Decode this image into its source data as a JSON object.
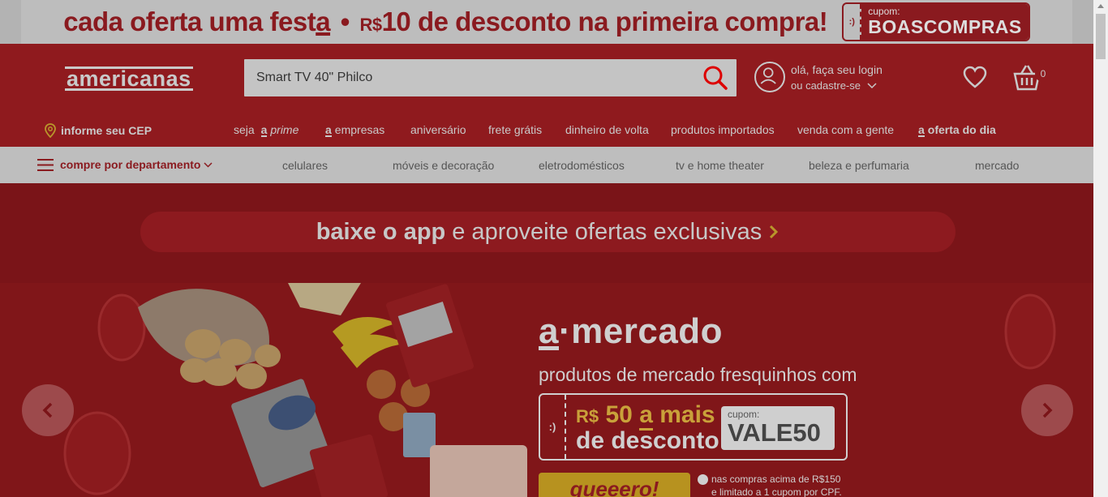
{
  "promo": {
    "text_pre": "cada oferta uma fest",
    "text_a": "a",
    "text_sep": "•",
    "currency": "R$",
    "text_post": "10 de desconto na primeira compra!",
    "coupon_stub": ":)",
    "coupon_label": "cupom:",
    "coupon_code": "BOASCOMPRAS"
  },
  "header": {
    "logo": "americanas",
    "search": {
      "value": "Smart TV 40\" Philco",
      "placeholder": ""
    },
    "login_line1": "olá, faça seu login",
    "login_line2": "ou cadastre-se",
    "cart_count": "0"
  },
  "subnav": {
    "cep": "informe seu CEP",
    "items": [
      {
        "prefix": "seja",
        "mark": "a",
        "label": "prime"
      },
      {
        "mark": "a",
        "label": "empresas"
      },
      {
        "label": "aniversário"
      },
      {
        "label": "frete grátis"
      },
      {
        "label": "dinheiro de volta"
      },
      {
        "label": "produtos importados"
      },
      {
        "label": "venda com a gente"
      },
      {
        "mark": "a",
        "label": "oferta do dia"
      }
    ]
  },
  "deptbar": {
    "toggle": "compre por departamento",
    "items": [
      "celulares",
      "móveis e decoração",
      "eletrodomésticos",
      "tv e home theater",
      "beleza e perfumaria",
      "mercado"
    ]
  },
  "main": {
    "app_banner_bold": "baixe o app",
    "app_banner_rest": "e aproveite ofertas exclusivas",
    "hero": {
      "title_mark": "a",
      "title_rest": "·mercado",
      "subtitle": "produtos de mercado fresquinhos com",
      "coupon_stub": ":)",
      "coupon_currency": "R$",
      "coupon_value": "50",
      "coupon_mark": "a",
      "coupon_more": "mais",
      "coupon_line2": "de desconto",
      "code_label": "cupom:",
      "code": "VALE50",
      "cta": "queeero!",
      "terms_line1": "nas compras acima de R$150",
      "terms_line2": "e limitado a 1 cupom por CPF."
    }
  },
  "colors": {
    "header_bg": "#8f1a1e",
    "promo_text": "#8a1a1f",
    "accent_gold": "#b7921f"
  }
}
